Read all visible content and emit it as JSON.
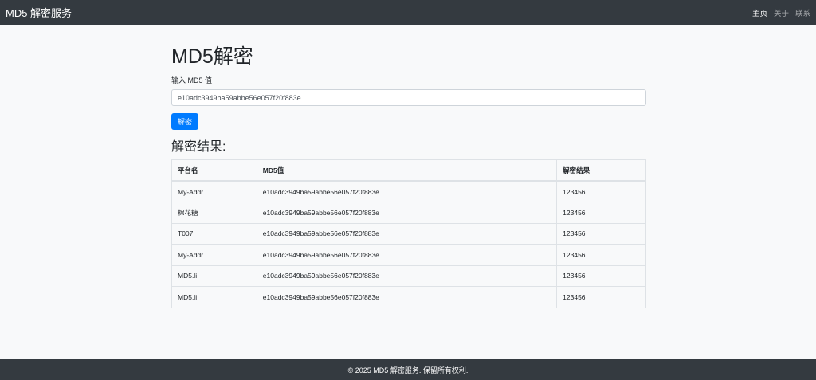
{
  "nav": {
    "brand": "MD5 解密服务",
    "links": [
      "主页",
      "关于",
      "联系"
    ]
  },
  "main": {
    "title": "MD5解密",
    "input_label": "输入 MD5 值",
    "input_value": "e10adc3949ba59abbe56e057f20f883e",
    "button_label": "解密",
    "result_title": "解密结果:"
  },
  "table": {
    "headers": [
      "平台名",
      "MD5值",
      "解密结果"
    ],
    "rows": [
      [
        "My-Addr",
        "e10adc3949ba59abbe56e057f20f883e",
        "123456"
      ],
      [
        "棉花糖",
        "e10adc3949ba59abbe56e057f20f883e",
        "123456"
      ],
      [
        "T007",
        "e10adc3949ba59abbe56e057f20f883e",
        "123456"
      ],
      [
        "My-Addr",
        "e10adc3949ba59abbe56e057f20f883e",
        "123456"
      ],
      [
        "MD5.li",
        "e10adc3949ba59abbe56e057f20f883e",
        "123456"
      ],
      [
        "MD5.li",
        "e10adc3949ba59abbe56e057f20f883e",
        "123456"
      ]
    ]
  },
  "footer": {
    "text": "© 2025 MD5 解密服务. 保留所有权利."
  },
  "colors": {
    "navbar": "#343a40",
    "primary": "#007bff",
    "background": "#f8f9fa"
  }
}
